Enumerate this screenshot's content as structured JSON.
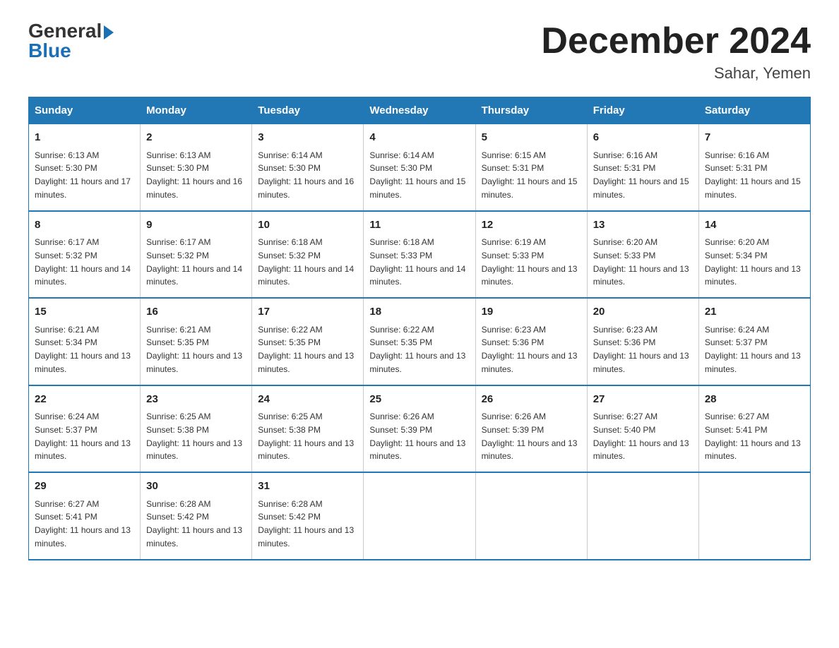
{
  "logo": {
    "general": "General",
    "blue": "Blue",
    "arrow": "▶"
  },
  "title": "December 2024",
  "location": "Sahar, Yemen",
  "days_of_week": [
    "Sunday",
    "Monday",
    "Tuesday",
    "Wednesday",
    "Thursday",
    "Friday",
    "Saturday"
  ],
  "weeks": [
    [
      {
        "day": "1",
        "sunrise": "6:13 AM",
        "sunset": "5:30 PM",
        "daylight": "11 hours and 17 minutes."
      },
      {
        "day": "2",
        "sunrise": "6:13 AM",
        "sunset": "5:30 PM",
        "daylight": "11 hours and 16 minutes."
      },
      {
        "day": "3",
        "sunrise": "6:14 AM",
        "sunset": "5:30 PM",
        "daylight": "11 hours and 16 minutes."
      },
      {
        "day": "4",
        "sunrise": "6:14 AM",
        "sunset": "5:30 PM",
        "daylight": "11 hours and 15 minutes."
      },
      {
        "day": "5",
        "sunrise": "6:15 AM",
        "sunset": "5:31 PM",
        "daylight": "11 hours and 15 minutes."
      },
      {
        "day": "6",
        "sunrise": "6:16 AM",
        "sunset": "5:31 PM",
        "daylight": "11 hours and 15 minutes."
      },
      {
        "day": "7",
        "sunrise": "6:16 AM",
        "sunset": "5:31 PM",
        "daylight": "11 hours and 15 minutes."
      }
    ],
    [
      {
        "day": "8",
        "sunrise": "6:17 AM",
        "sunset": "5:32 PM",
        "daylight": "11 hours and 14 minutes."
      },
      {
        "day": "9",
        "sunrise": "6:17 AM",
        "sunset": "5:32 PM",
        "daylight": "11 hours and 14 minutes."
      },
      {
        "day": "10",
        "sunrise": "6:18 AM",
        "sunset": "5:32 PM",
        "daylight": "11 hours and 14 minutes."
      },
      {
        "day": "11",
        "sunrise": "6:18 AM",
        "sunset": "5:33 PM",
        "daylight": "11 hours and 14 minutes."
      },
      {
        "day": "12",
        "sunrise": "6:19 AM",
        "sunset": "5:33 PM",
        "daylight": "11 hours and 13 minutes."
      },
      {
        "day": "13",
        "sunrise": "6:20 AM",
        "sunset": "5:33 PM",
        "daylight": "11 hours and 13 minutes."
      },
      {
        "day": "14",
        "sunrise": "6:20 AM",
        "sunset": "5:34 PM",
        "daylight": "11 hours and 13 minutes."
      }
    ],
    [
      {
        "day": "15",
        "sunrise": "6:21 AM",
        "sunset": "5:34 PM",
        "daylight": "11 hours and 13 minutes."
      },
      {
        "day": "16",
        "sunrise": "6:21 AM",
        "sunset": "5:35 PM",
        "daylight": "11 hours and 13 minutes."
      },
      {
        "day": "17",
        "sunrise": "6:22 AM",
        "sunset": "5:35 PM",
        "daylight": "11 hours and 13 minutes."
      },
      {
        "day": "18",
        "sunrise": "6:22 AM",
        "sunset": "5:35 PM",
        "daylight": "11 hours and 13 minutes."
      },
      {
        "day": "19",
        "sunrise": "6:23 AM",
        "sunset": "5:36 PM",
        "daylight": "11 hours and 13 minutes."
      },
      {
        "day": "20",
        "sunrise": "6:23 AM",
        "sunset": "5:36 PM",
        "daylight": "11 hours and 13 minutes."
      },
      {
        "day": "21",
        "sunrise": "6:24 AM",
        "sunset": "5:37 PM",
        "daylight": "11 hours and 13 minutes."
      }
    ],
    [
      {
        "day": "22",
        "sunrise": "6:24 AM",
        "sunset": "5:37 PM",
        "daylight": "11 hours and 13 minutes."
      },
      {
        "day": "23",
        "sunrise": "6:25 AM",
        "sunset": "5:38 PM",
        "daylight": "11 hours and 13 minutes."
      },
      {
        "day": "24",
        "sunrise": "6:25 AM",
        "sunset": "5:38 PM",
        "daylight": "11 hours and 13 minutes."
      },
      {
        "day": "25",
        "sunrise": "6:26 AM",
        "sunset": "5:39 PM",
        "daylight": "11 hours and 13 minutes."
      },
      {
        "day": "26",
        "sunrise": "6:26 AM",
        "sunset": "5:39 PM",
        "daylight": "11 hours and 13 minutes."
      },
      {
        "day": "27",
        "sunrise": "6:27 AM",
        "sunset": "5:40 PM",
        "daylight": "11 hours and 13 minutes."
      },
      {
        "day": "28",
        "sunrise": "6:27 AM",
        "sunset": "5:41 PM",
        "daylight": "11 hours and 13 minutes."
      }
    ],
    [
      {
        "day": "29",
        "sunrise": "6:27 AM",
        "sunset": "5:41 PM",
        "daylight": "11 hours and 13 minutes."
      },
      {
        "day": "30",
        "sunrise": "6:28 AM",
        "sunset": "5:42 PM",
        "daylight": "11 hours and 13 minutes."
      },
      {
        "day": "31",
        "sunrise": "6:28 AM",
        "sunset": "5:42 PM",
        "daylight": "11 hours and 13 minutes."
      },
      null,
      null,
      null,
      null
    ]
  ]
}
